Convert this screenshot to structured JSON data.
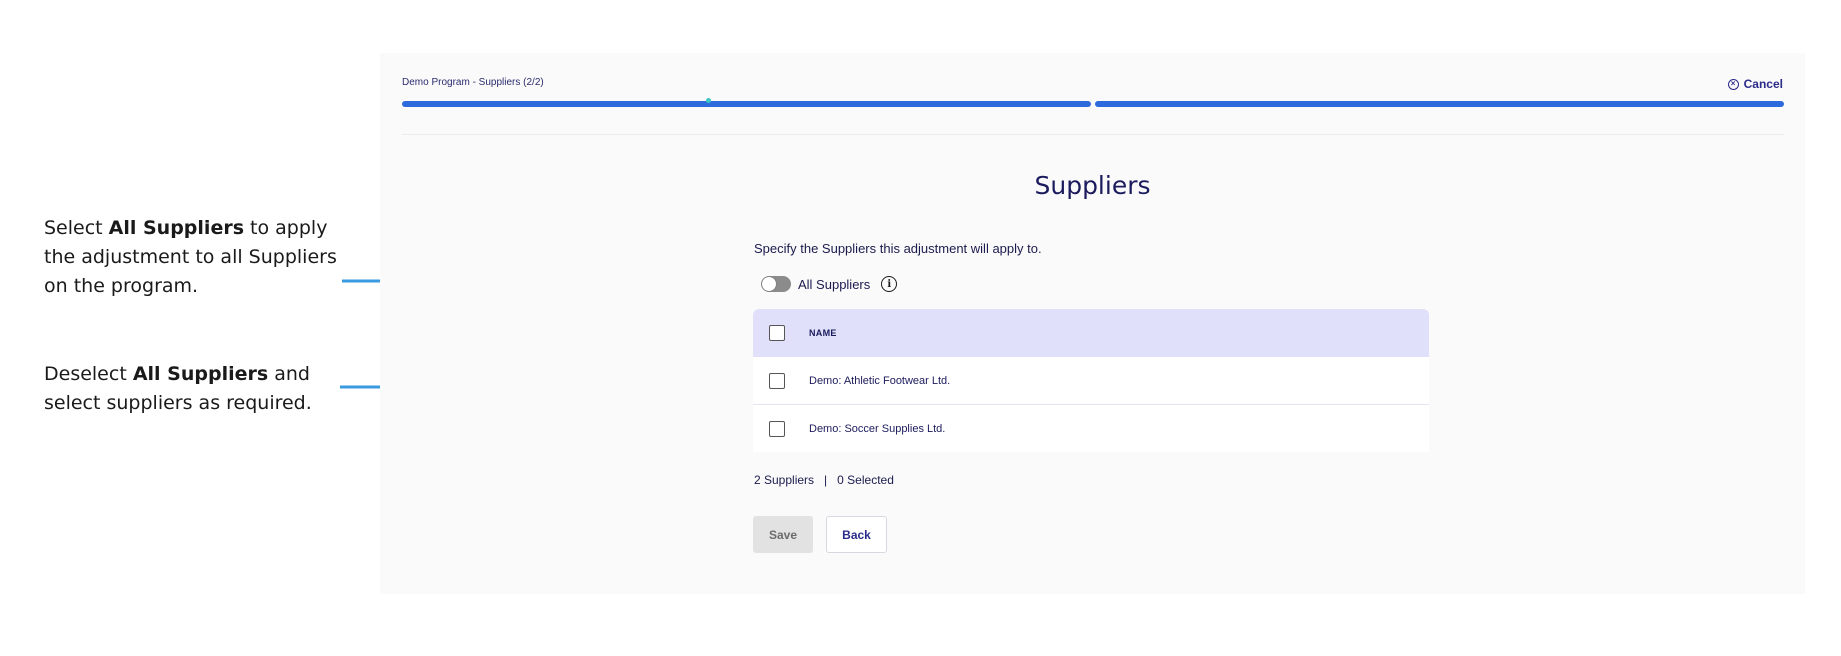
{
  "annotations": {
    "first": {
      "pre": "Select ",
      "bold": "All Suppliers",
      "post": " to apply the adjustment to all Suppliers on the program."
    },
    "second": {
      "pre": "Deselect ",
      "bold": "All Suppliers",
      "post": " and select suppliers as required."
    }
  },
  "header": {
    "wizard_title": "Demo Program - Suppliers (2/2)",
    "cancel_label": "Cancel",
    "steps_total": 2,
    "steps_completed": 2
  },
  "main": {
    "title": "Suppliers",
    "subtitle": "Specify the Suppliers this adjustment will apply to.",
    "toggle_label": "All Suppliers",
    "toggle_on": false,
    "table": {
      "header_name": "NAME",
      "rows": [
        {
          "name": "Demo: Athletic Footwear Ltd.",
          "checked": false
        },
        {
          "name": "Demo: Soccer Supplies Ltd.",
          "checked": false
        }
      ]
    },
    "summary": {
      "count": "2 Suppliers",
      "separator": "|",
      "selected": "0 Selected"
    },
    "buttons": {
      "save": "Save",
      "back": "Back"
    }
  },
  "colors": {
    "accent_progress": "#2d6bdc",
    "arrow": "#3a9ae0",
    "table_header_bg": "#e0e0fa",
    "title_text": "#1b1b5e"
  }
}
